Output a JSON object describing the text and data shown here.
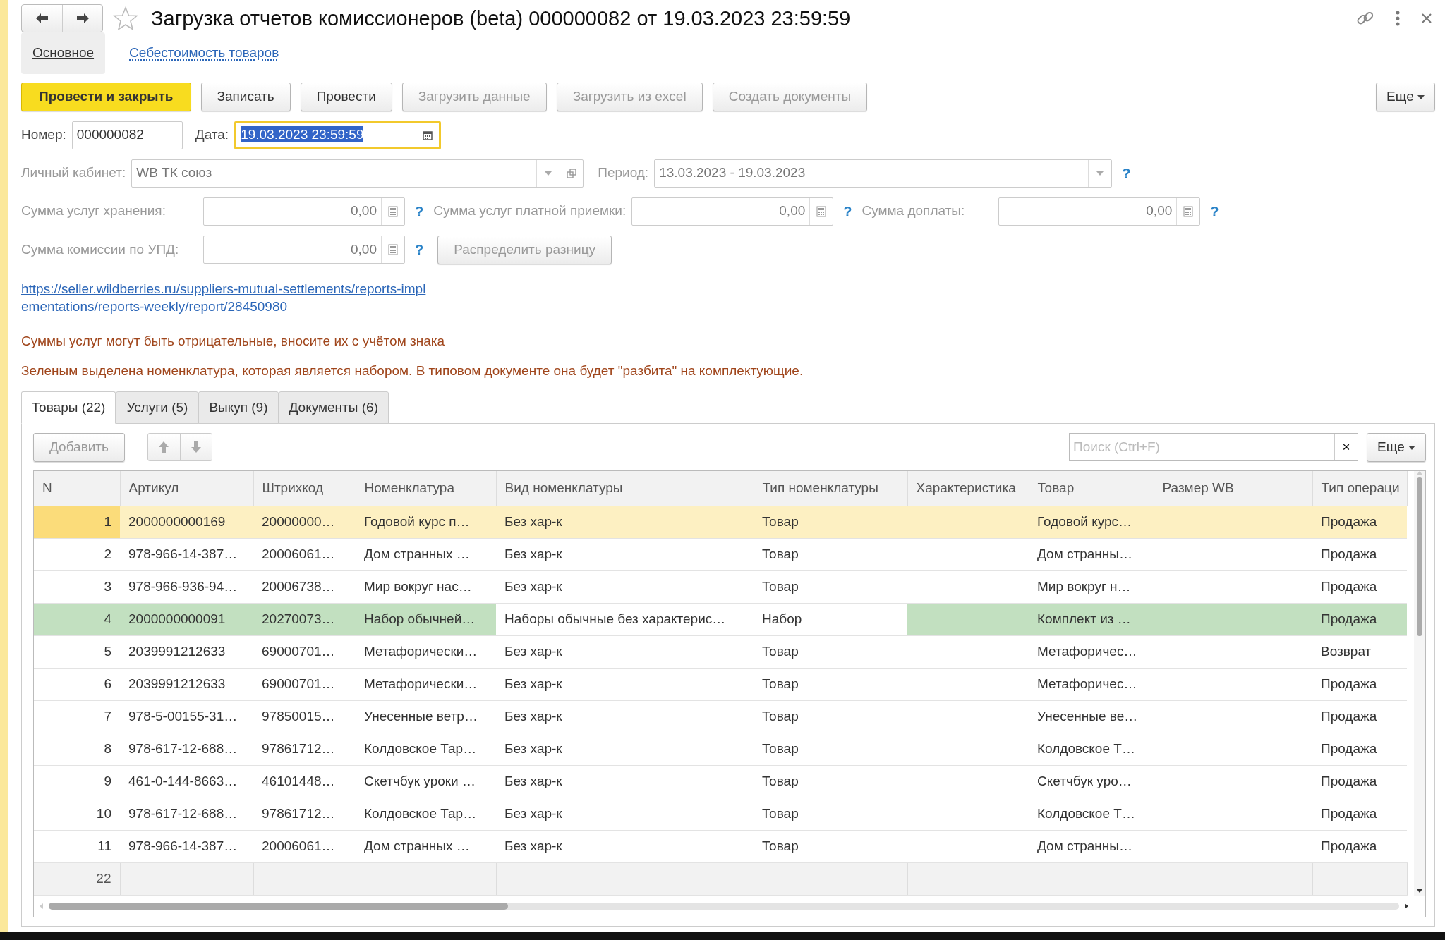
{
  "header": {
    "title": "Загрузка отчетов комиссионеров (beta) 000000082 от 19.03.2023 23:59:59"
  },
  "form_tabs": [
    {
      "label": "Основное",
      "selected": true
    },
    {
      "label": "Себестоимость товаров",
      "selected": false
    }
  ],
  "command_bar": {
    "buttons": [
      {
        "label": "Провести и закрыть",
        "kind": "default",
        "disabled": false
      },
      {
        "label": "Записать",
        "kind": "normal",
        "disabled": false
      },
      {
        "label": "Провести",
        "kind": "normal",
        "disabled": false
      },
      {
        "label": "Загрузить данные",
        "kind": "normal",
        "disabled": true
      },
      {
        "label": "Загрузить из excel",
        "kind": "normal",
        "disabled": true
      },
      {
        "label": "Создать документы",
        "kind": "normal",
        "disabled": true
      }
    ],
    "more": "Еще"
  },
  "number": {
    "label": "Номер:",
    "value": "000000082"
  },
  "date": {
    "label": "Дата:",
    "value": "19.03.2023 23:59:59",
    "focused": true
  },
  "cabinet": {
    "label": "Личный кабинет:",
    "value": "WB ТК союз",
    "disabled": true
  },
  "period": {
    "label": "Период:",
    "value": "13.03.2023 - 19.03.2023",
    "disabled": true,
    "help": "?"
  },
  "sums": [
    {
      "label": "Сумма услуг хранения:",
      "value": "0,00",
      "help": "?"
    },
    {
      "label": "Сумма услуг платной приемки:",
      "value": "0,00",
      "help": "?"
    },
    {
      "label": "Сумма доплаты:",
      "value": "0,00",
      "help": "?"
    }
  ],
  "commission": {
    "label": "Сумма комиссии по УПД:",
    "value": "0,00",
    "help": "?",
    "button": "Распределить разницу"
  },
  "report_link": {
    "lines": [
      "https://seller.wildberries.ru/suppliers-mutual-settlements/reports-impl",
      "ementations/reports-weekly/report/28450980"
    ]
  },
  "notes": [
    "Суммы услуг могут быть отрицательные, вносите их  с учётом знака",
    "Зеленым выделена номенклатура, которая является набором. В типовом документе она будет \"разбита\" на комплектующие."
  ],
  "table_tabs": [
    {
      "label": "Товары (22)",
      "selected": true
    },
    {
      "label": "Услуги (5)",
      "selected": false
    },
    {
      "label": "Выкуп (9)",
      "selected": false
    },
    {
      "label": "Документы (6)",
      "selected": false
    }
  ],
  "table_toolbar": {
    "add": "Добавить",
    "search_placeholder": "Поиск (Ctrl+F)",
    "clear": "×",
    "more": "Еще"
  },
  "table": {
    "columns": [
      {
        "label": "N",
        "kit_highlight": true
      },
      {
        "label": "Артикул",
        "kit_highlight": true
      },
      {
        "label": "Штрихкод",
        "kit_highlight": true
      },
      {
        "label": "Номенклатура",
        "kit_highlight": true
      },
      {
        "label": "Вид номенклатуры",
        "kit_highlight": false
      },
      {
        "label": "Тип номенклатуры",
        "kit_highlight": false
      },
      {
        "label": "Характеристика",
        "kit_highlight": true
      },
      {
        "label": "Товар",
        "kit_highlight": true
      },
      {
        "label": "Размер WB",
        "kit_highlight": true
      },
      {
        "label": "Тип операци",
        "kit_highlight": true
      }
    ],
    "rows": [
      {
        "n": "1",
        "artikul": "2000000000169",
        "shtrikhkod": "20000000…",
        "nomenklatura": "Годовой курс п…",
        "vid": "Без хар-к",
        "tip": "Товар",
        "tovar": "Годовой курс…",
        "operatsiya": "Продажа",
        "selected": true,
        "kit": false
      },
      {
        "n": "2",
        "artikul": "978-966-14-387…",
        "shtrikhkod": "20006061…",
        "nomenklatura": "Дом странных …",
        "vid": "Без хар-к",
        "tip": "Товар",
        "tovar": "Дом странны…",
        "operatsiya": "Продажа",
        "selected": false,
        "kit": false
      },
      {
        "n": "3",
        "artikul": "978-966-936-94…",
        "shtrikhkod": "20006738…",
        "nomenklatura": "Мир вокруг нас…",
        "vid": "Без хар-к",
        "tip": "Товар",
        "tovar": "Мир вокруг н…",
        "operatsiya": "Продажа",
        "selected": false,
        "kit": false
      },
      {
        "n": "4",
        "artikul": "2000000000091",
        "shtrikhkod": "20270073…",
        "nomenklatura": "Набор обычней…",
        "vid": "Наборы обычные без характерис…",
        "tip": "Набор",
        "tovar": "Комплект из …",
        "operatsiya": "Продажа",
        "selected": false,
        "kit": true
      },
      {
        "n": "5",
        "artikul": "2039991212633",
        "shtrikhkod": "69000701…",
        "nomenklatura": "Метафорически…",
        "vid": "Без хар-к",
        "tip": "Товар",
        "tovar": "Метафоричес…",
        "operatsiya": "Возврат",
        "selected": false,
        "kit": false
      },
      {
        "n": "6",
        "artikul": "2039991212633",
        "shtrikhkod": "69000701…",
        "nomenklatura": "Метафорически…",
        "vid": "Без хар-к",
        "tip": "Товар",
        "tovar": "Метафоричес…",
        "operatsiya": "Продажа",
        "selected": false,
        "kit": false
      },
      {
        "n": "7",
        "artikul": "978-5-00155-31…",
        "shtrikhkod": "97850015…",
        "nomenklatura": "Унесенные ветр…",
        "vid": "Без хар-к",
        "tip": "Товар",
        "tovar": "Унесенные ве…",
        "operatsiya": "Продажа",
        "selected": false,
        "kit": false
      },
      {
        "n": "8",
        "artikul": "978-617-12-688…",
        "shtrikhkod": "97861712…",
        "nomenklatura": "Колдовское Тар…",
        "vid": "Без хар-к",
        "tip": "Товар",
        "tovar": "Колдовское Т…",
        "operatsiya": "Продажа",
        "selected": false,
        "kit": false
      },
      {
        "n": "9",
        "artikul": "461-0-144-8663…",
        "shtrikhkod": "46101448…",
        "nomenklatura": "Скетчбук уроки …",
        "vid": "Без хар-к",
        "tip": "Товар",
        "tovar": "Скетчбук уро…",
        "operatsiya": "Продажа",
        "selected": false,
        "kit": false
      },
      {
        "n": "10",
        "artikul": "978-617-12-688…",
        "shtrikhkod": "97861712…",
        "nomenklatura": "Колдовское Тар…",
        "vid": "Без хар-к",
        "tip": "Товар",
        "tovar": "Колдовское Т…",
        "operatsiya": "Продажа",
        "selected": false,
        "kit": false
      },
      {
        "n": "11",
        "artikul": "978-966-14-387…",
        "shtrikhkod": "20006061…",
        "nomenklatura": "Дом странных …",
        "vid": "Без хар-к",
        "tip": "Товар",
        "tovar": "Дом странны…",
        "operatsiya": "Продажа",
        "selected": false,
        "kit": false
      }
    ],
    "footer_count": "22"
  }
}
